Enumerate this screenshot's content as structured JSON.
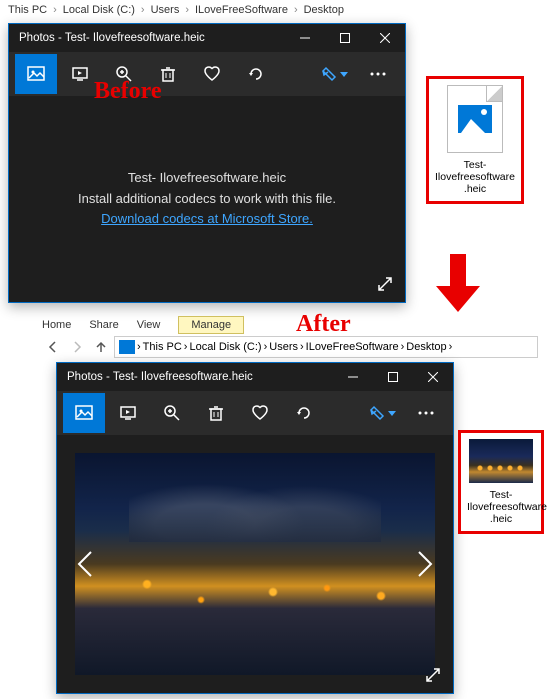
{
  "breadcrumb_top": [
    "This PC",
    "Local Disk (C:)",
    "Users",
    "ILoveFreeSoftware",
    "Desktop"
  ],
  "labels": {
    "before": "Before",
    "after": "After"
  },
  "photos_before": {
    "title": "Photos - Test- Ilovefreesoftware.heic",
    "filename": "Test- Ilovefreesoftware.heic",
    "msg": "Install additional codecs to work with this file.",
    "link": "Download codecs at Microsoft Store."
  },
  "file_before": {
    "line1": "Test-",
    "line2": "Ilovefreesoftware",
    "line3": ".heic"
  },
  "explorer": {
    "tabs": [
      "Home",
      "Share",
      "View",
      "Manage"
    ]
  },
  "breadcrumb_bottom": [
    "This PC",
    "Local Disk (C:)",
    "Users",
    "ILoveFreeSoftware",
    "Desktop"
  ],
  "photos_after": {
    "title": "Photos - Test- Ilovefreesoftware.heic"
  },
  "file_after": {
    "line1": "Test-",
    "line2": "Ilovefreesoftware",
    "line3": ".heic"
  }
}
